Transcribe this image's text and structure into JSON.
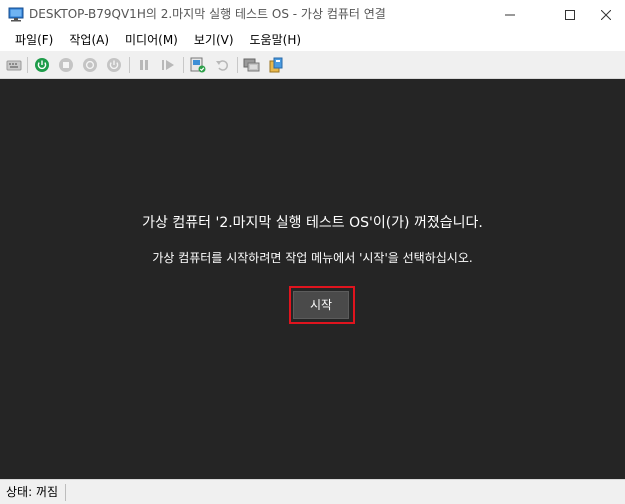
{
  "window": {
    "title": "DESKTOP-B79QV1H의 2.마지막 실행 테스트 OS - 가상 컴퓨터 연결"
  },
  "menu": {
    "items": [
      "파일(F)",
      "작업(A)",
      "미디어(M)",
      "보기(V)",
      "도움말(H)"
    ]
  },
  "toolbar": {
    "buttons": [
      "ctrl-alt-del-icon",
      "power-on-icon",
      "stop-icon",
      "shutdown-icon",
      "power-off-icon",
      "pause-icon",
      "resume-icon",
      "checkpoint-icon",
      "revert-icon",
      "enhanced-session-icon",
      "share-icon"
    ]
  },
  "screen": {
    "message_main": "가상 컴퓨터 '2.마지막 실행 테스트 OS'이(가) 꺼졌습니다.",
    "message_sub": "가상 컴퓨터를 시작하려면 작업 메뉴에서 '시작'을 선택하십시오.",
    "start_button_label": "시작",
    "highlight_color": "#e0141e"
  },
  "status": {
    "text": "상태: 꺼짐"
  }
}
